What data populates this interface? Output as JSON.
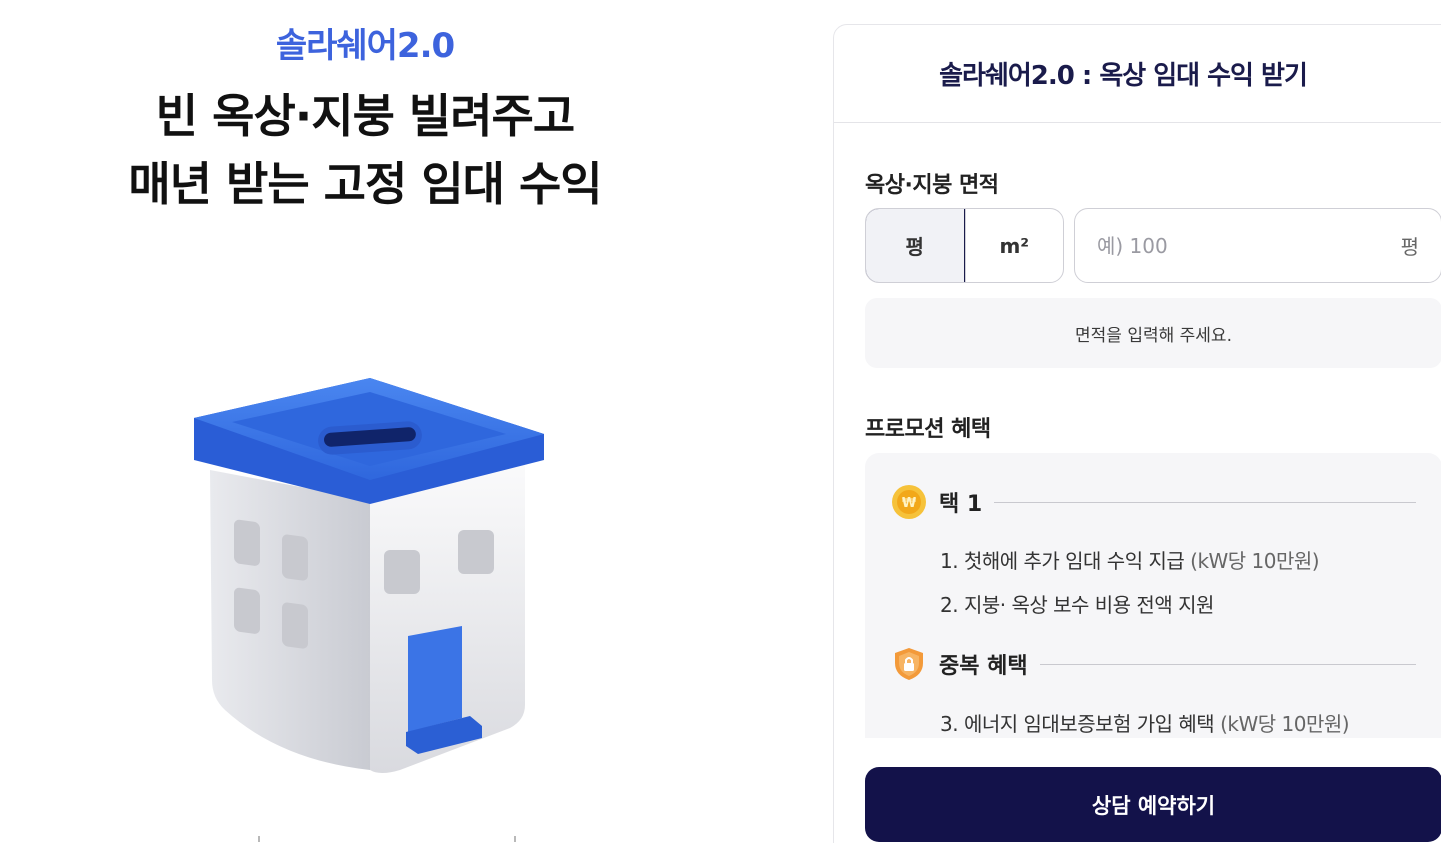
{
  "hero": {
    "brand": "솔라쉐어2.0",
    "headline_line1": "빈 옥상·지붕 빌려주고",
    "headline_line2": "매년 받는 고정 임대 수익"
  },
  "panel": {
    "title": "솔라쉐어2.0 : 옥상 임대 수익 받기",
    "area_label": "옥상·지붕 면적",
    "unit_options": [
      "평",
      "m²"
    ],
    "selected_unit": "평",
    "area_placeholder": "예) 100",
    "area_value": "",
    "area_suffix": "평",
    "result_message": "면적을 입력해 주세요.",
    "promo_label": "프로모션 혜택",
    "promo_groups": [
      {
        "title": "택 1",
        "icon": "won-coin-icon",
        "items": [
          {
            "text": "1. 첫해에 추가 임대 수익 지급",
            "note": "(kW당 10만원)"
          },
          {
            "text": "2. 지붕· 옥상 보수 비용 전액 지원",
            "note": ""
          }
        ]
      },
      {
        "title": "중복 혜택",
        "icon": "lock-shield-icon",
        "items": [
          {
            "text": "3. 에너지 임대보증보험 가입 혜택",
            "note": "(kW당 10만원)"
          }
        ]
      }
    ],
    "cta_label": "상담 예약하기"
  },
  "colors": {
    "brand_blue": "#3d63dd",
    "navy": "#13124a",
    "coin_gold": "#f2b01e",
    "shield_orange": "#f08a2c"
  }
}
